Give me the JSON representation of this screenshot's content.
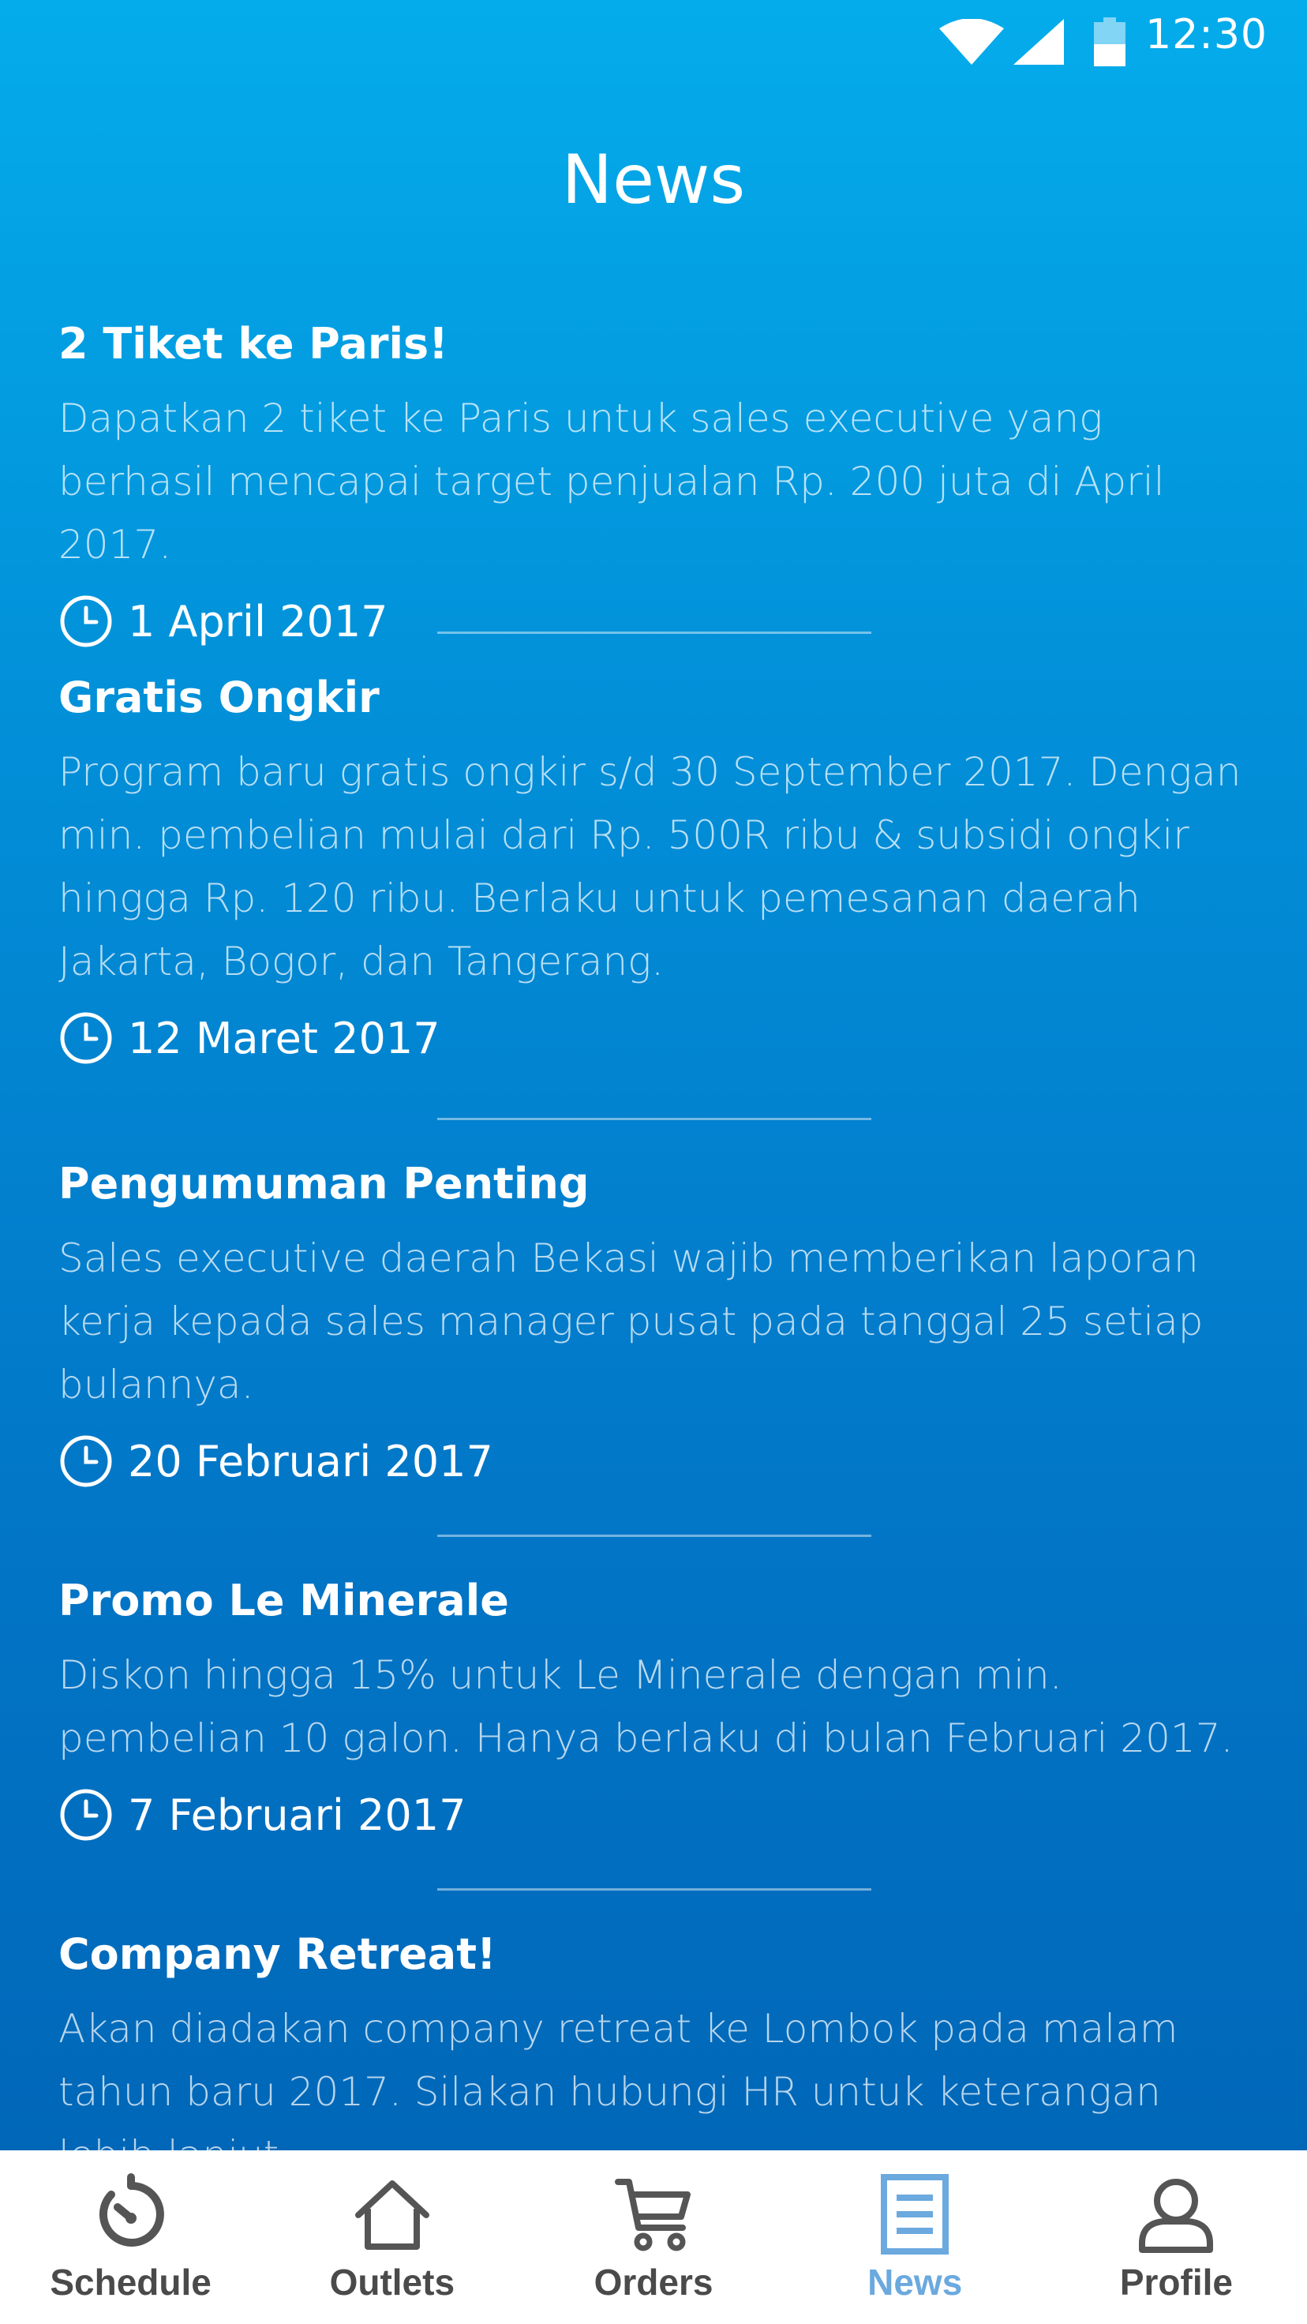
{
  "status_bar": {
    "time": "12:30"
  },
  "header": {
    "title": "News"
  },
  "news": [
    {
      "title": "2 Tiket ke Paris!",
      "body": "Dapatkan 2 tiket ke Paris untuk sales executive yang berhasil mencapai target penjualan Rp. 200 juta di April 2017.",
      "date": "1 April 2017"
    },
    {
      "title": "Gratis Ongkir",
      "body": "Program baru gratis ongkir s/d 30 September 2017. Dengan min. pembelian mulai dari Rp. 500R ribu & subsidi ongkir hingga Rp. 120 ribu. Berlaku untuk pemesanan daerah Jakarta, Bogor, dan Tangerang.",
      "date": "12 Maret 2017"
    },
    {
      "title": "Pengumuman Penting",
      "body": "Sales executive daerah Bekasi wajib memberikan laporan kerja kepada sales manager pusat pada tanggal 25 setiap bulannya.",
      "date": "20 Februari 2017"
    },
    {
      "title": "Promo Le Minerale",
      "body": "Diskon hingga 15% untuk Le Minerale dengan min. pembelian 10 galon. Hanya berlaku di bulan Februari 2017.",
      "date": "7 Februari 2017"
    },
    {
      "title": "Company Retreat!",
      "body": "Akan diadakan company retreat ke Lombok pada malam tahun baru 2017. Silakan hubungi HR untuk keterangan lebih lanjut."
    }
  ],
  "bottom_nav": {
    "items": [
      {
        "label": "Schedule",
        "icon": "schedule-icon"
      },
      {
        "label": "Outlets",
        "icon": "home-icon"
      },
      {
        "label": "Orders",
        "icon": "cart-icon"
      },
      {
        "label": "News",
        "icon": "news-icon",
        "active": true
      },
      {
        "label": "Profile",
        "icon": "profile-icon"
      }
    ],
    "active_color": "#6ba9de",
    "inactive_color": "#4a4a4a"
  }
}
